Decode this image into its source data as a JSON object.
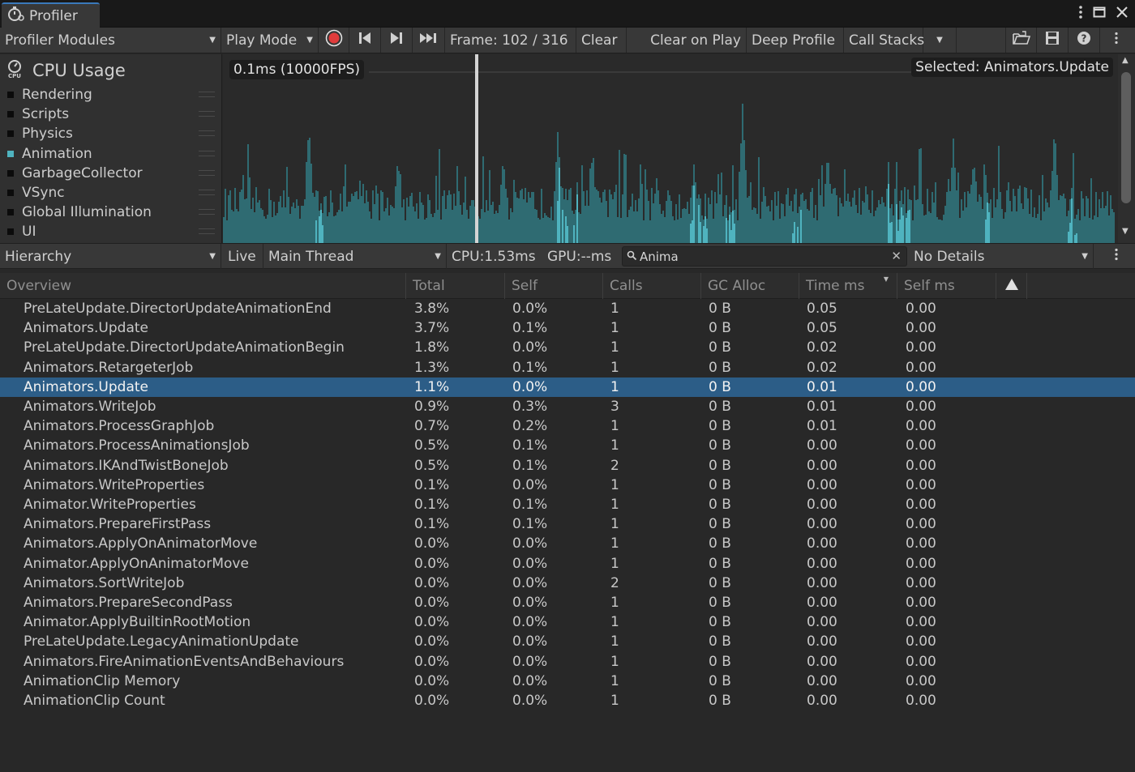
{
  "window": {
    "tab_title": "Profiler"
  },
  "toolbar": {
    "modules_dropdown": "Profiler Modules",
    "play_mode": "Play Mode",
    "frame": "Frame: 102 / 316",
    "clear": "Clear",
    "clear_on_play": "Clear on Play",
    "deep_profile": "Deep Profile",
    "call_stacks": "Call Stacks"
  },
  "module": {
    "title": "CPU Usage",
    "legend": [
      {
        "name": "Rendering",
        "color": "#0b0b0b"
      },
      {
        "name": "Scripts",
        "color": "#0b0b0b"
      },
      {
        "name": "Physics",
        "color": "#0b0b0b"
      },
      {
        "name": "Animation",
        "color": "#4fb3bf"
      },
      {
        "name": "GarbageCollector",
        "color": "#0b0b0b"
      },
      {
        "name": "VSync",
        "color": "#0b0b0b"
      },
      {
        "name": "Global Illumination",
        "color": "#0b0b0b"
      },
      {
        "name": "UI",
        "color": "#0b0b0b"
      }
    ]
  },
  "chart": {
    "scale_label": "0.1ms (10000FPS)",
    "selected_label": "Selected: Animators.Update",
    "fill_color": "#2f6b72",
    "highlight_color": "#4fb3bf"
  },
  "details_bar": {
    "view": "Hierarchy",
    "live": "Live",
    "thread": "Main Thread",
    "cpu": "CPU:1.53ms",
    "gpu": "GPU:--ms",
    "search_value": "Anima",
    "details": "No Details"
  },
  "table": {
    "columns": [
      "Overview",
      "Total",
      "Self",
      "Calls",
      "GC Alloc",
      "Time ms",
      "Self ms"
    ],
    "selected_index": 4,
    "rows": [
      [
        "PreLateUpdate.DirectorUpdateAnimationEnd",
        "3.8%",
        "0.0%",
        "1",
        "0 B",
        "0.05",
        "0.00"
      ],
      [
        "Animators.Update",
        "3.7%",
        "0.1%",
        "1",
        "0 B",
        "0.05",
        "0.00"
      ],
      [
        "PreLateUpdate.DirectorUpdateAnimationBegin",
        "1.8%",
        "0.0%",
        "1",
        "0 B",
        "0.02",
        "0.00"
      ],
      [
        "Animators.RetargeterJob",
        "1.3%",
        "0.1%",
        "1",
        "0 B",
        "0.02",
        "0.00"
      ],
      [
        "Animators.Update",
        "1.1%",
        "0.0%",
        "1",
        "0 B",
        "0.01",
        "0.00"
      ],
      [
        "Animators.WriteJob",
        "0.9%",
        "0.3%",
        "3",
        "0 B",
        "0.01",
        "0.00"
      ],
      [
        "Animators.ProcessGraphJob",
        "0.7%",
        "0.2%",
        "1",
        "0 B",
        "0.01",
        "0.00"
      ],
      [
        "Animators.ProcessAnimationsJob",
        "0.5%",
        "0.1%",
        "1",
        "0 B",
        "0.00",
        "0.00"
      ],
      [
        "Animators.IKAndTwistBoneJob",
        "0.5%",
        "0.1%",
        "2",
        "0 B",
        "0.00",
        "0.00"
      ],
      [
        "Animators.WriteProperties",
        "0.1%",
        "0.0%",
        "1",
        "0 B",
        "0.00",
        "0.00"
      ],
      [
        "Animator.WriteProperties",
        "0.1%",
        "0.1%",
        "1",
        "0 B",
        "0.00",
        "0.00"
      ],
      [
        "Animators.PrepareFirstPass",
        "0.1%",
        "0.1%",
        "1",
        "0 B",
        "0.00",
        "0.00"
      ],
      [
        "Animators.ApplyOnAnimatorMove",
        "0.0%",
        "0.0%",
        "1",
        "0 B",
        "0.00",
        "0.00"
      ],
      [
        "Animator.ApplyOnAnimatorMove",
        "0.0%",
        "0.0%",
        "1",
        "0 B",
        "0.00",
        "0.00"
      ],
      [
        "Animators.SortWriteJob",
        "0.0%",
        "0.0%",
        "2",
        "0 B",
        "0.00",
        "0.00"
      ],
      [
        "Animators.PrepareSecondPass",
        "0.0%",
        "0.0%",
        "1",
        "0 B",
        "0.00",
        "0.00"
      ],
      [
        "Animator.ApplyBuiltinRootMotion",
        "0.0%",
        "0.0%",
        "1",
        "0 B",
        "0.00",
        "0.00"
      ],
      [
        "PreLateUpdate.LegacyAnimationUpdate",
        "0.0%",
        "0.0%",
        "1",
        "0 B",
        "0.00",
        "0.00"
      ],
      [
        "Animators.FireAnimationEventsAndBehaviours",
        "0.0%",
        "0.0%",
        "1",
        "0 B",
        "0.00",
        "0.00"
      ],
      [
        "AnimationClip Memory",
        "0.0%",
        "0.0%",
        "1",
        "0 B",
        "0.00",
        "0.00"
      ],
      [
        "AnimationClip Count",
        "0.0%",
        "0.0%",
        "1",
        "0 B",
        "0.00",
        "0.00"
      ]
    ]
  }
}
